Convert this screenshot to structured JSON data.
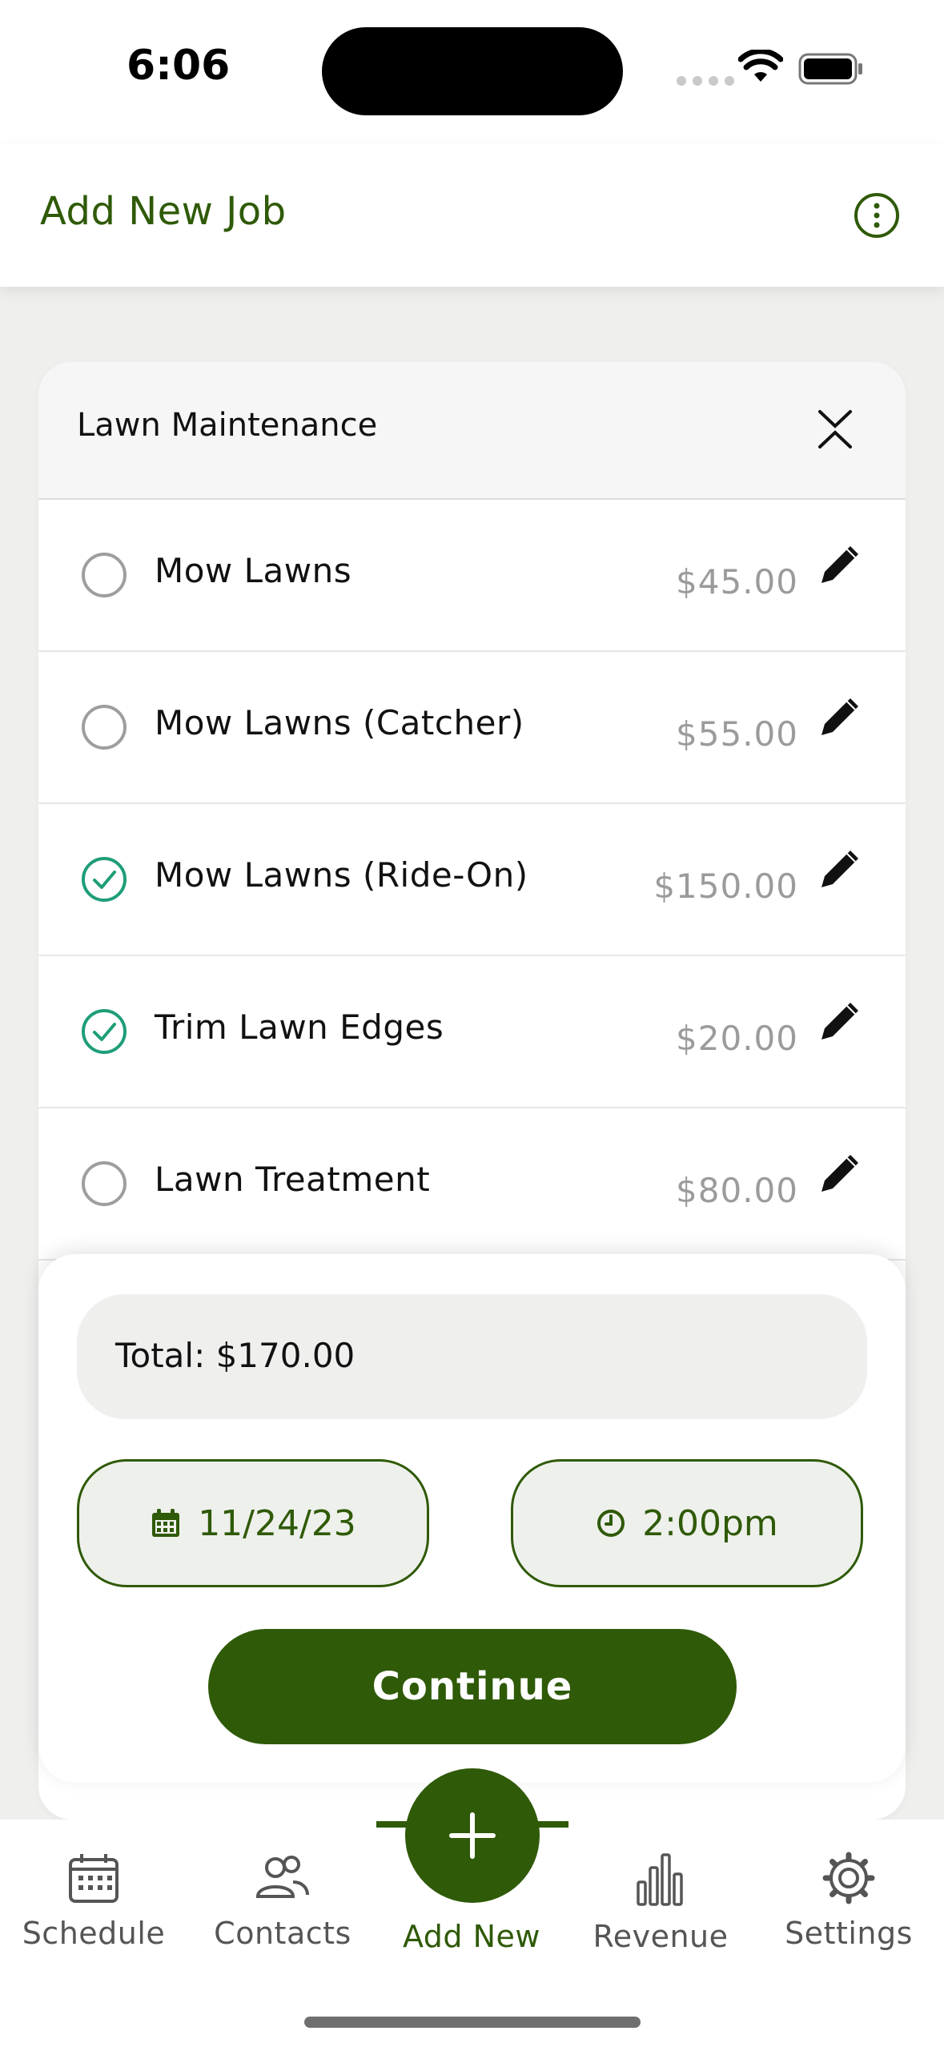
{
  "status_bar": {
    "time": "6:06"
  },
  "header": {
    "title": "Add New Job",
    "more_icon": "more-vertical-icon"
  },
  "card": {
    "title": "Lawn Maintenance",
    "items": [
      {
        "label": "Mow Lawns",
        "price": "$45.00",
        "checked": false
      },
      {
        "label": "Mow Lawns (Catcher)",
        "price": "$55.00",
        "checked": false
      },
      {
        "label": "Mow Lawns (Ride-On)",
        "price": "$150.00",
        "checked": true
      },
      {
        "label": "Trim Lawn Edges",
        "price": "$20.00",
        "checked": true
      },
      {
        "label": "Lawn Treatment",
        "price": "$80.00",
        "checked": false
      }
    ]
  },
  "summary": {
    "total": "Total: $170.00",
    "date": "11/24/23",
    "time": "2:00pm",
    "continue_label": "Continue"
  },
  "tabbar": {
    "tabs": [
      {
        "label": "Schedule",
        "icon": "calendar-icon"
      },
      {
        "label": "Contacts",
        "icon": "users-icon"
      },
      {
        "label": "Add New",
        "icon": "plus-icon",
        "active": true
      },
      {
        "label": "Revenue",
        "icon": "bar-chart-icon"
      },
      {
        "label": "Settings",
        "icon": "gear-icon"
      }
    ]
  },
  "colors": {
    "brand": "#2f5a08",
    "check": "#1e9e78",
    "muted": "#9b9b9b"
  }
}
